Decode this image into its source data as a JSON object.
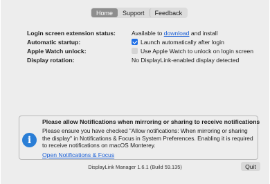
{
  "tabs": [
    {
      "label": "Home",
      "selected": true
    },
    {
      "label": "Support",
      "selected": false
    },
    {
      "label": "Feedback",
      "selected": false
    }
  ],
  "settings": {
    "login_extension": {
      "label": "Login screen extension status:",
      "value_prefix": "Available to",
      "link": "download",
      "value_suffix": "and install"
    },
    "auto_startup": {
      "label": "Automatic startup:",
      "checkbox_label": "Launch automatically after login",
      "checked": true
    },
    "apple_watch": {
      "label": "Apple Watch unlock:",
      "checkbox_label": "Use Apple Watch to unlock on login screen",
      "checked": false,
      "enabled": false
    },
    "display_rotation": {
      "label": "Display rotation:",
      "value": "No DisplayLink-enabled display detected"
    }
  },
  "notice": {
    "title": "Please allow Notifications when mirroring or sharing to receive notifications",
    "body": "Please ensure you have checked \"Allow notifications: When mirroring or sharing the display\" in Notifications & Focus in System Preferences. Enabling it is required to receive notifications on macOS Monterey.",
    "link": "Open Notifications & Focus",
    "icon": "info-icon"
  },
  "footer": {
    "version": "DisplayLink Manager 1.6.1 (Build 59.135)",
    "quit_label": "Quit"
  },
  "colors": {
    "accent": "#1f6fe6",
    "link": "#1a5fd6",
    "info_icon": "#2a7ed6",
    "window_bg": "#ededed",
    "selected_tab": "#8e8e8e"
  }
}
